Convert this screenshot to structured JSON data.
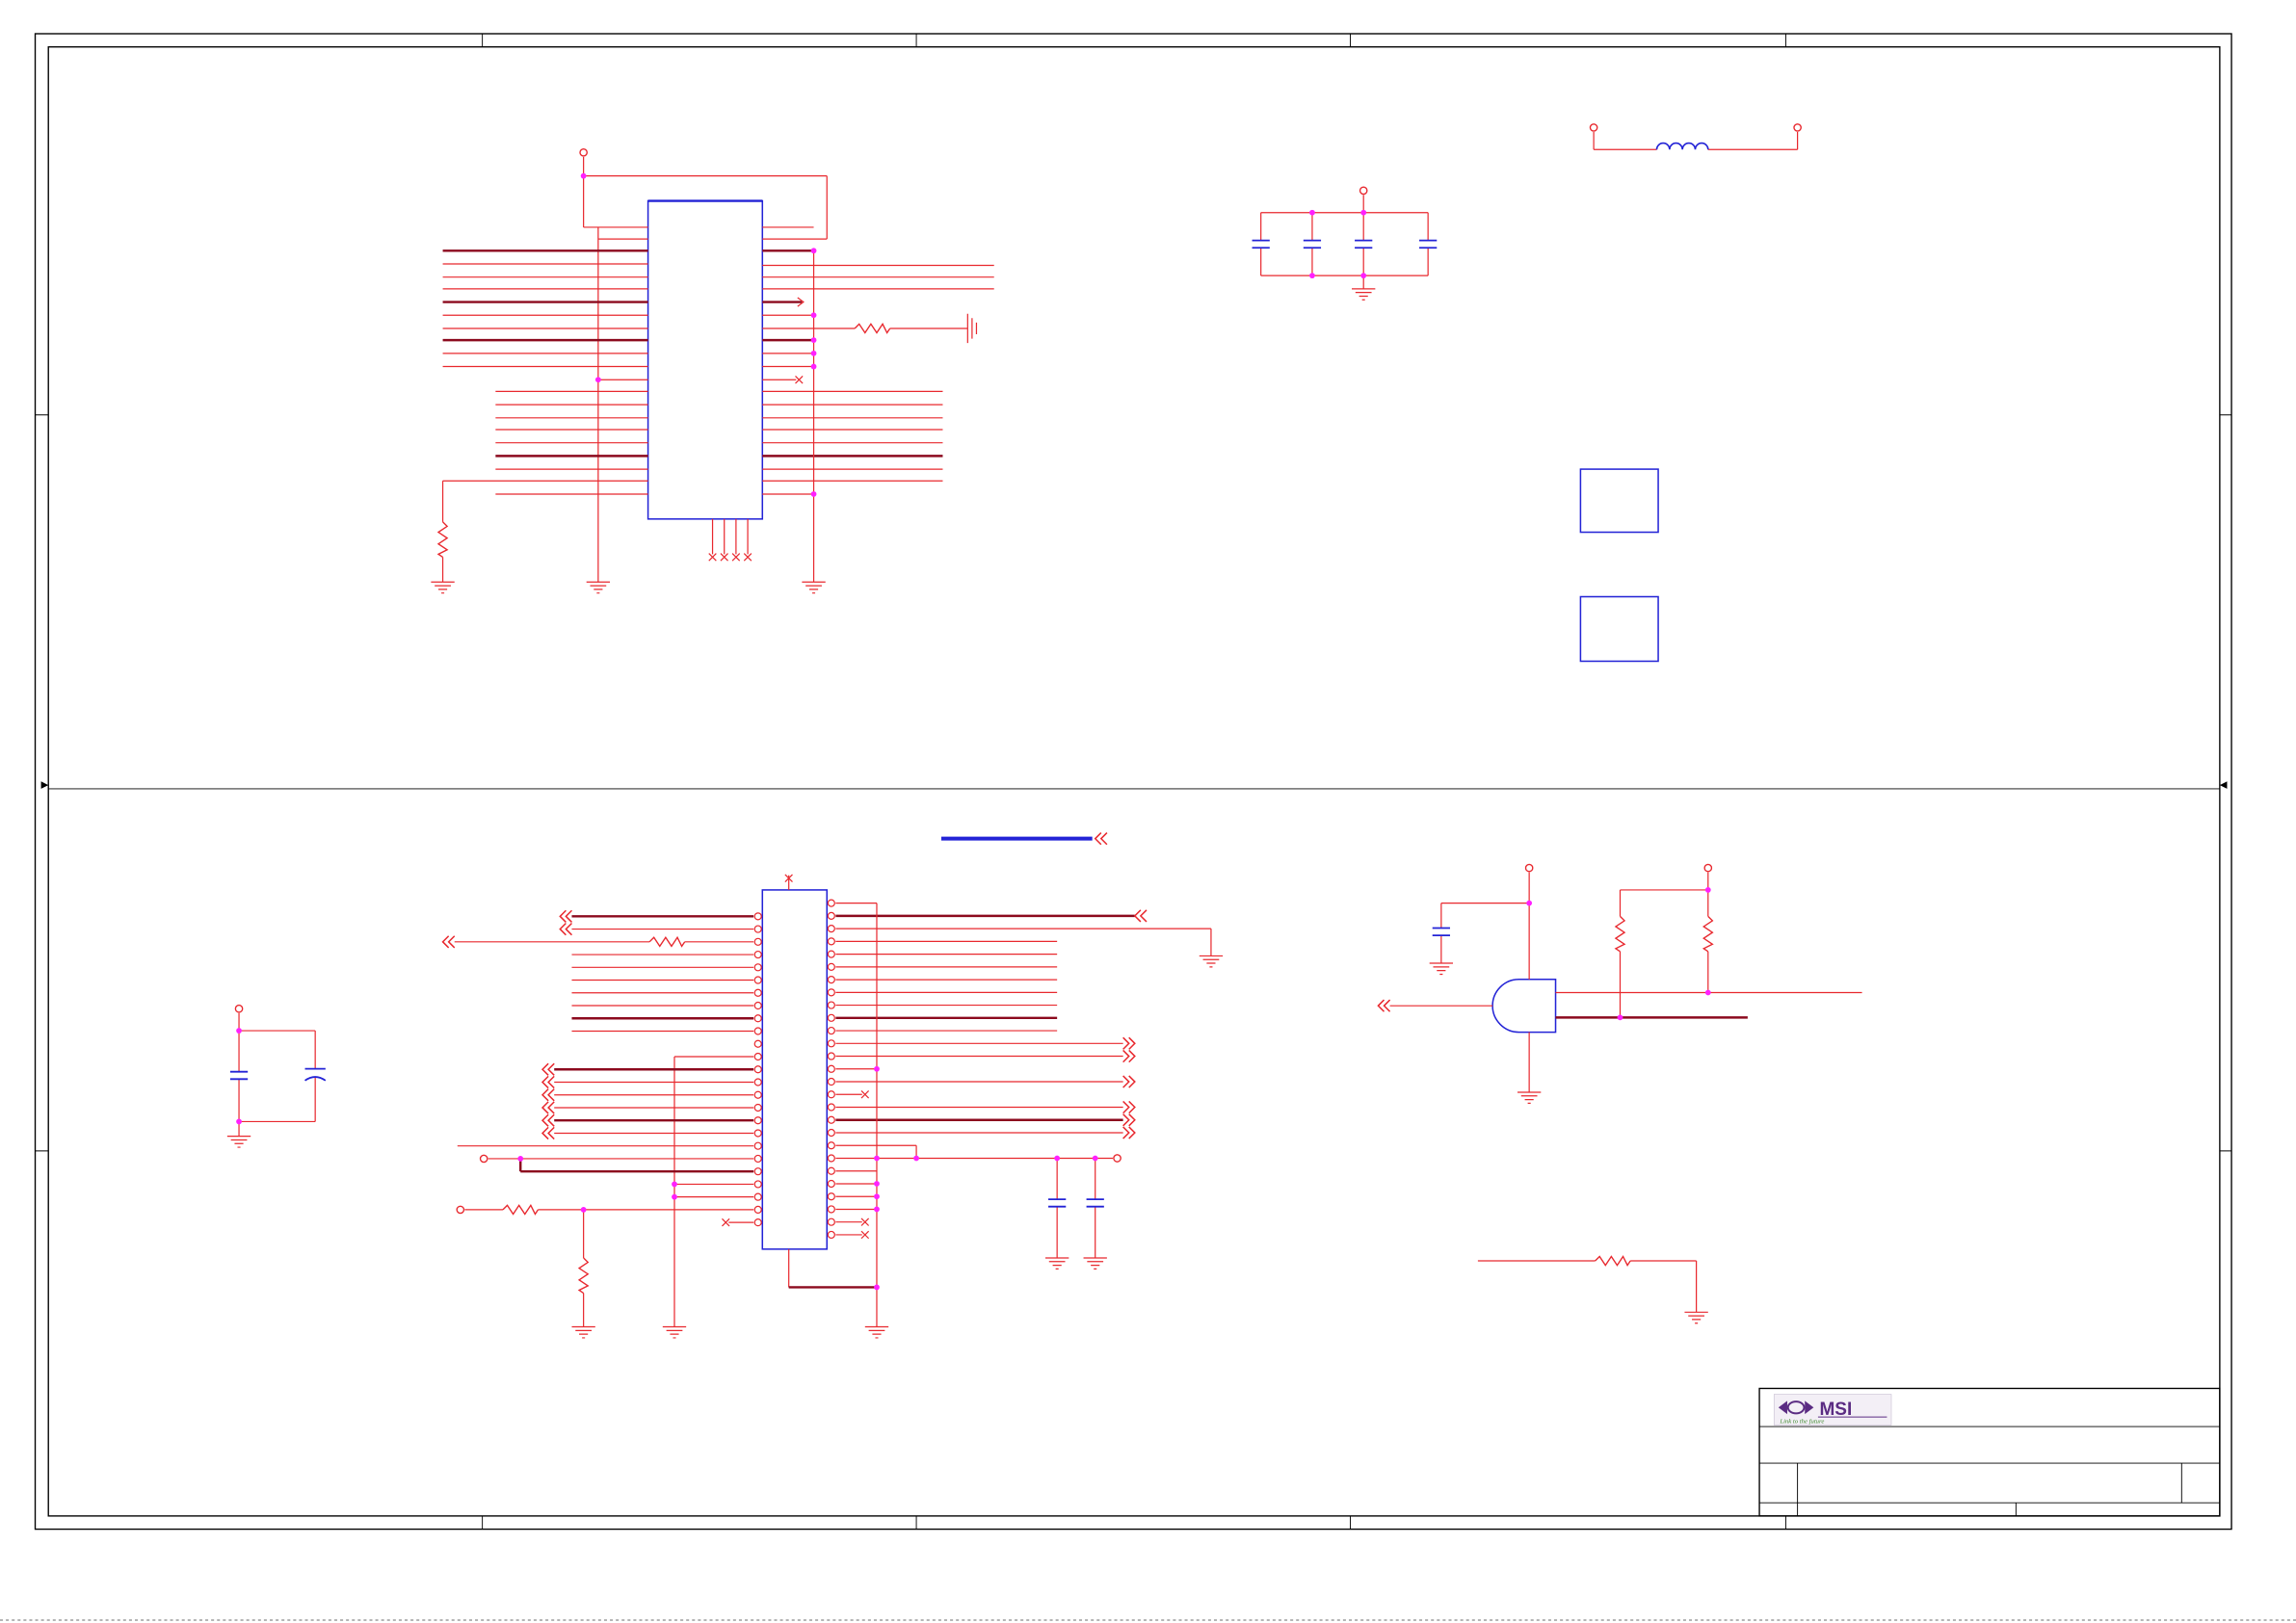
{
  "logo": {
    "brand": "MSI",
    "tagline": "Link to the future"
  },
  "colors": {
    "wire": "#e8282e",
    "bus_wire": "#8c0a1e",
    "part_outline": "#2323d6",
    "junction": "#ff20ff",
    "frame": "#000000",
    "logo_purple": "#5b2c83",
    "logo_green": "#3d8a2e"
  }
}
